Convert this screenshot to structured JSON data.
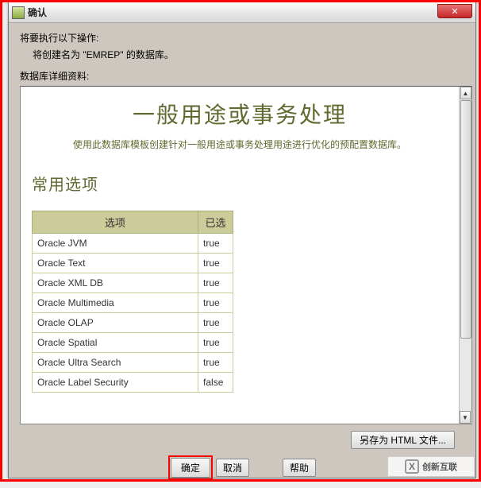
{
  "window": {
    "title": "确认",
    "close_glyph": "✕"
  },
  "body": {
    "instruction": "将要执行以下操作:",
    "instruction_sub": "将创建名为 \"EMREP\" 的数据库。",
    "detail_label": "数据库详细资料:"
  },
  "panel": {
    "main_title": "一般用途或事务处理",
    "sub_title": "使用此数据库模板创建针对一般用途或事务处理用途进行优化的预配置数据库。",
    "section_title": "常用选项",
    "table": {
      "col_option": "选项",
      "col_selected": "已选",
      "rows": [
        {
          "opt": "Oracle JVM",
          "sel": "true"
        },
        {
          "opt": "Oracle Text",
          "sel": "true"
        },
        {
          "opt": "Oracle XML DB",
          "sel": "true"
        },
        {
          "opt": "Oracle Multimedia",
          "sel": "true"
        },
        {
          "opt": "Oracle OLAP",
          "sel": "true"
        },
        {
          "opt": "Oracle Spatial",
          "sel": "true"
        },
        {
          "opt": "Oracle Ultra Search",
          "sel": "true"
        },
        {
          "opt": "Oracle Label Security",
          "sel": "false"
        }
      ]
    }
  },
  "buttons": {
    "save_html": "另存为 HTML 文件...",
    "ok": "确定",
    "cancel": "取消",
    "help": "帮助"
  },
  "watermark": "创新互联"
}
